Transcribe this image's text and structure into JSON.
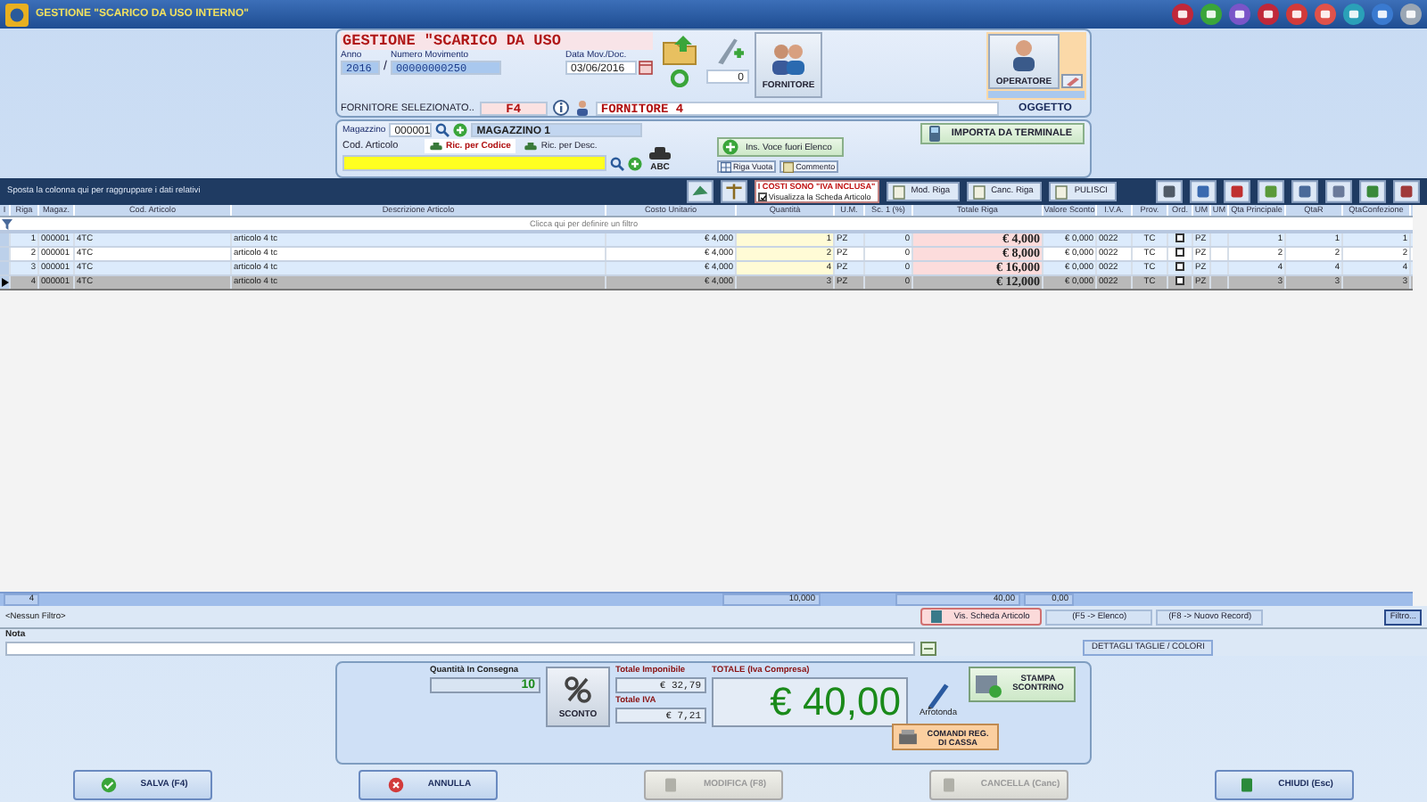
{
  "window": {
    "title": "GESTIONE \"SCARICO DA USO INTERNO\""
  },
  "header": {
    "title": "GESTIONE \"SCARICO DA USO",
    "anno_label": "Anno",
    "anno": "2016",
    "separator": "/",
    "numero_label": "Numero Movimento",
    "numero": "00000000250",
    "data_label": "Data Mov./Doc.",
    "data": "03/06/2016",
    "counter": "0",
    "fornitore_button": "FORNITORE",
    "fornitore_label": "FORNITORE SELEZIONATO..",
    "fornitore_code": "F4",
    "fornitore_name": "FORNITORE 4",
    "operatore_button": "OPERATORE",
    "oggetto_label": "OGGETTO"
  },
  "articolo": {
    "magazzino_label": "Magazzino",
    "magazzino_code": "000001",
    "magazzino_name": "MAGAZZINO 1",
    "cod_label": "Cod. Articolo",
    "abc_label": "ABC",
    "ins_button": "Ins. Voce fuori Elenco",
    "riga_vuota": "Riga Vuota",
    "commento": "Commento",
    "importa": "IMPORTA DA TERMINALE",
    "search_tabs": [
      {
        "label": "Ric. per Codice",
        "selected": true
      },
      {
        "label": "Ric. per Desc.",
        "selected": false
      }
    ]
  },
  "toolbar": {
    "group_hint": "Sposta la colonna qui per raggruppare i dati relativi",
    "iva_notice": "I COSTI SONO \"IVA INCLUSA\"",
    "scheda_check": {
      "label": "Visualizza la Scheda Articolo",
      "checked": true
    },
    "buttons": [
      "Mod. Riga",
      "Canc. Riga",
      "PULISCI"
    ]
  },
  "table": {
    "columns": [
      "I",
      "Riga",
      "Magaz.",
      "Cod. Articolo",
      "Descrizione Articolo",
      "Costo Unitario",
      "Quantità",
      "U.M.",
      "Sc. 1 (%)",
      "Totale Riga",
      "Valore Sconto",
      "I.V.A.",
      "Prov.",
      "Ord.",
      "UM",
      "UM",
      "Qta Principale",
      "QtaR",
      "QtaConfezione"
    ],
    "filter_hint": "Clicca qui per definire un filtro",
    "rows": [
      {
        "riga": "1",
        "magaz": "000001",
        "cod": "4TC",
        "desc": "articolo 4 tc",
        "costo": "€ 4,000",
        "quantita": "1",
        "um": "PZ",
        "sconto": "0",
        "totale": "€ 4,000",
        "valore_sconto": "€ 0,000",
        "iva": "0022",
        "prov": "TC",
        "ord": false,
        "um_1": "PZ",
        "qta_principale": "1",
        "qtar": "1",
        "qta_confezione": "1",
        "selected": false
      },
      {
        "riga": "2",
        "magaz": "000001",
        "cod": "4TC",
        "desc": "articolo 4 tc",
        "costo": "€ 4,000",
        "quantita": "2",
        "um": "PZ",
        "sconto": "0",
        "totale": "€ 8,000",
        "valore_sconto": "€ 0,000",
        "iva": "0022",
        "prov": "TC",
        "ord": false,
        "um_1": "PZ",
        "qta_principale": "2",
        "qtar": "2",
        "qta_confezione": "2",
        "selected": false
      },
      {
        "riga": "3",
        "magaz": "000001",
        "cod": "4TC",
        "desc": "articolo 4 tc",
        "costo": "€ 4,000",
        "quantita": "4",
        "um": "PZ",
        "sconto": "0",
        "totale": "€ 16,000",
        "valore_sconto": "€ 0,000",
        "iva": "0022",
        "prov": "TC",
        "ord": false,
        "um_1": "PZ",
        "qta_principale": "4",
        "qtar": "4",
        "qta_confezione": "4",
        "selected": false
      },
      {
        "riga": "4",
        "magaz": "000001",
        "cod": "4TC",
        "desc": "articolo 4 tc",
        "costo": "€ 4,000",
        "quantita": "3",
        "um": "PZ",
        "sconto": "0",
        "totale": "€ 12,000",
        "valore_sconto": "€ 0,000",
        "iva": "0022",
        "prov": "TC",
        "ord": false,
        "um_1": "PZ",
        "qta_principale": "3",
        "qtar": "3",
        "qta_confezione": "3",
        "selected": true
      }
    ],
    "footer": {
      "count": "4",
      "quantita": "10,000",
      "totale": "40,00",
      "sconto": "0,00"
    }
  },
  "filter_bar": {
    "filter": "<Nessun Filtro>",
    "scheda_button": "Vis. Scheda Articolo",
    "buttons": [
      "(F5 -> Elenco)",
      "(F8 -> Nuovo Record)"
    ],
    "filtro_button": "Filtro..."
  },
  "nota": {
    "label": "Nota",
    "dettagli_button": "DETTAGLI TAGLIE / COLORI"
  },
  "totals": {
    "quantita_label": "Quantità In Consegna",
    "quantita": "10",
    "sconto_button": "SCONTO",
    "imponibile_label": "Totale Imponibile",
    "imponibile": "€ 32,79",
    "iva_label": "Totale IVA",
    "iva": "€ 7,21",
    "totale_label": "TOTALE (Iva Compresa)",
    "totale": "€ 40,00",
    "arrotonda": "Arrotonda",
    "stampa_button": "STAMPA SCONTRINO",
    "comandi_button": "COMANDI REG. DI CASSA"
  },
  "actions": [
    {
      "label": "SALVA (F4)",
      "kind": "save",
      "disabled": false
    },
    {
      "label": "ANNULLA",
      "kind": "cancel",
      "disabled": false
    },
    {
      "label": "MODIFICA (F8)",
      "kind": "edit",
      "disabled": true
    },
    {
      "label": "CANCELLA (Canc)",
      "kind": "delete",
      "disabled": true
    },
    {
      "label": "CHIUDI (Esc)",
      "kind": "exit",
      "disabled": false
    }
  ]
}
